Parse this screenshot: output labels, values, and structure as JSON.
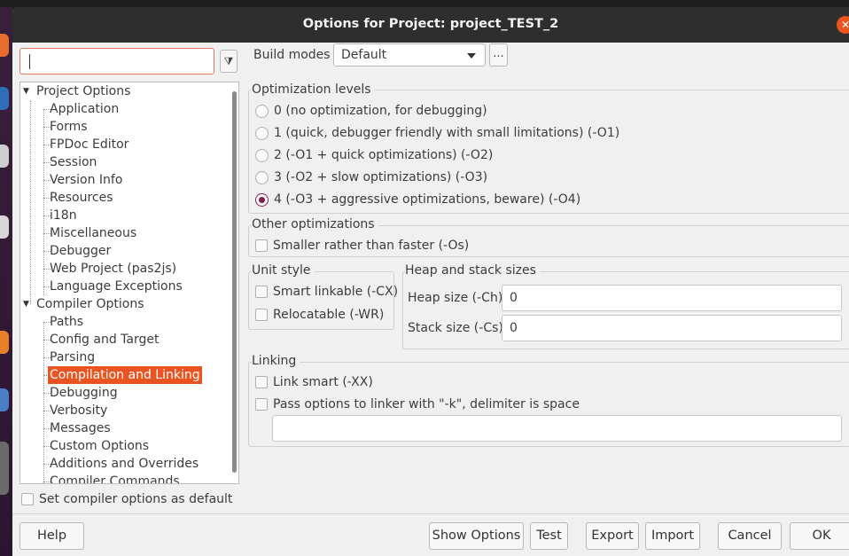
{
  "window": {
    "title": "Options for Project: project_TEST_2"
  },
  "search": {
    "value": ""
  },
  "tree": {
    "project_options": "Project Options",
    "project_children": [
      "Application",
      "Forms",
      "FPDoc Editor",
      "Session",
      "Version Info",
      "Resources",
      "i18n",
      "Miscellaneous",
      "Debugger",
      "Web Project (pas2js)",
      "Language Exceptions"
    ],
    "compiler_options": "Compiler Options",
    "compiler_children": [
      "Paths",
      "Config and Target",
      "Parsing",
      "Compilation and Linking",
      "Debugging",
      "Verbosity",
      "Messages",
      "Custom Options",
      "Additions and Overrides",
      "Compiler Commands"
    ],
    "selected": "Compilation and Linking"
  },
  "set_default_label": "Set compiler options as default",
  "build_modes": {
    "label": "Build modes",
    "value": "Default",
    "more": "..."
  },
  "optimization": {
    "title": "Optimization levels",
    "options": [
      "0 (no optimization, for debugging)",
      "1 (quick, debugger friendly with small limitations) (-O1)",
      "2 (-O1 + quick optimizations) (-O2)",
      "3 (-O2 + slow optimizations) (-O3)",
      "4 (-O3 + aggressive optimizations, beware) (-O4)"
    ],
    "selected_index": 4
  },
  "other": {
    "title": "Other optimizations",
    "smaller": "Smaller rather than faster (-Os)"
  },
  "unit_style": {
    "title": "Unit style",
    "smart": "Smart linkable (-CX)",
    "reloc": "Relocatable (-WR)"
  },
  "heap": {
    "title": "Heap and stack sizes",
    "heap_label": "Heap size (-Ch)",
    "heap_value": "0",
    "stack_label": "Stack size (-Cs)",
    "stack_value": "0"
  },
  "linking": {
    "title": "Linking",
    "smart": "Link smart (-XX)",
    "pass": "Pass options to linker with \"-k\", delimiter is space",
    "pass_value": ""
  },
  "buttons": {
    "help": "Help",
    "show_options": "Show Options",
    "test": "Test",
    "export": "Export",
    "import": "Import",
    "cancel": "Cancel",
    "ok": "OK"
  },
  "colors": {
    "accent": "#e95420",
    "radio": "#7a1e4f",
    "titlebar": "#2e2e2e"
  },
  "icons": {
    "filter": "filter-clear-icon",
    "close": "close-icon",
    "dropdown": "chevron-down-icon"
  }
}
